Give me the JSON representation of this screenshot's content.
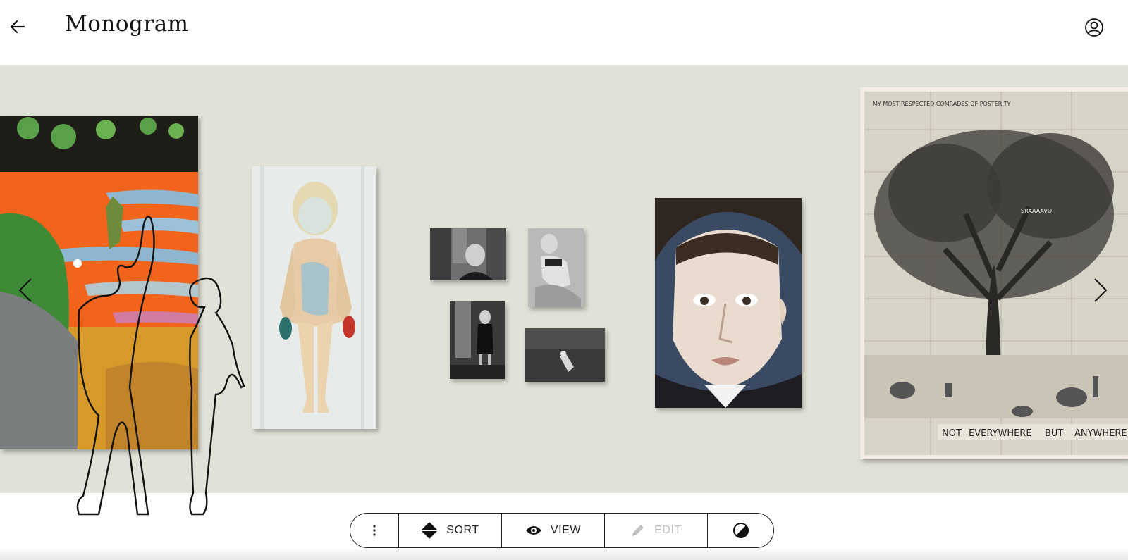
{
  "app": {
    "title": "Monogram"
  },
  "toolbar": {
    "sort_label": "SORT",
    "view_label": "VIEW",
    "edit_label": "EDIT"
  },
  "tree_print": {
    "caption_left": "NOT",
    "caption_mid": "EVERYWHERE",
    "caption_but": "BUT",
    "caption_right": "ANYWHERE",
    "header_text": "MY MOST RESPECTED COMRADES OF POSTERITY",
    "small_label": "SRAAAAVO"
  },
  "colors": {
    "wall": "#e1e2d7",
    "toolbar_border": "#222222",
    "disabled_text": "#bbbbbb"
  },
  "icons": [
    "back-arrow-icon",
    "account-icon",
    "more-vertical-icon",
    "sort-icon",
    "eye-icon",
    "pencil-icon",
    "contrast-icon",
    "chevron-left-icon",
    "chevron-right-icon"
  ]
}
